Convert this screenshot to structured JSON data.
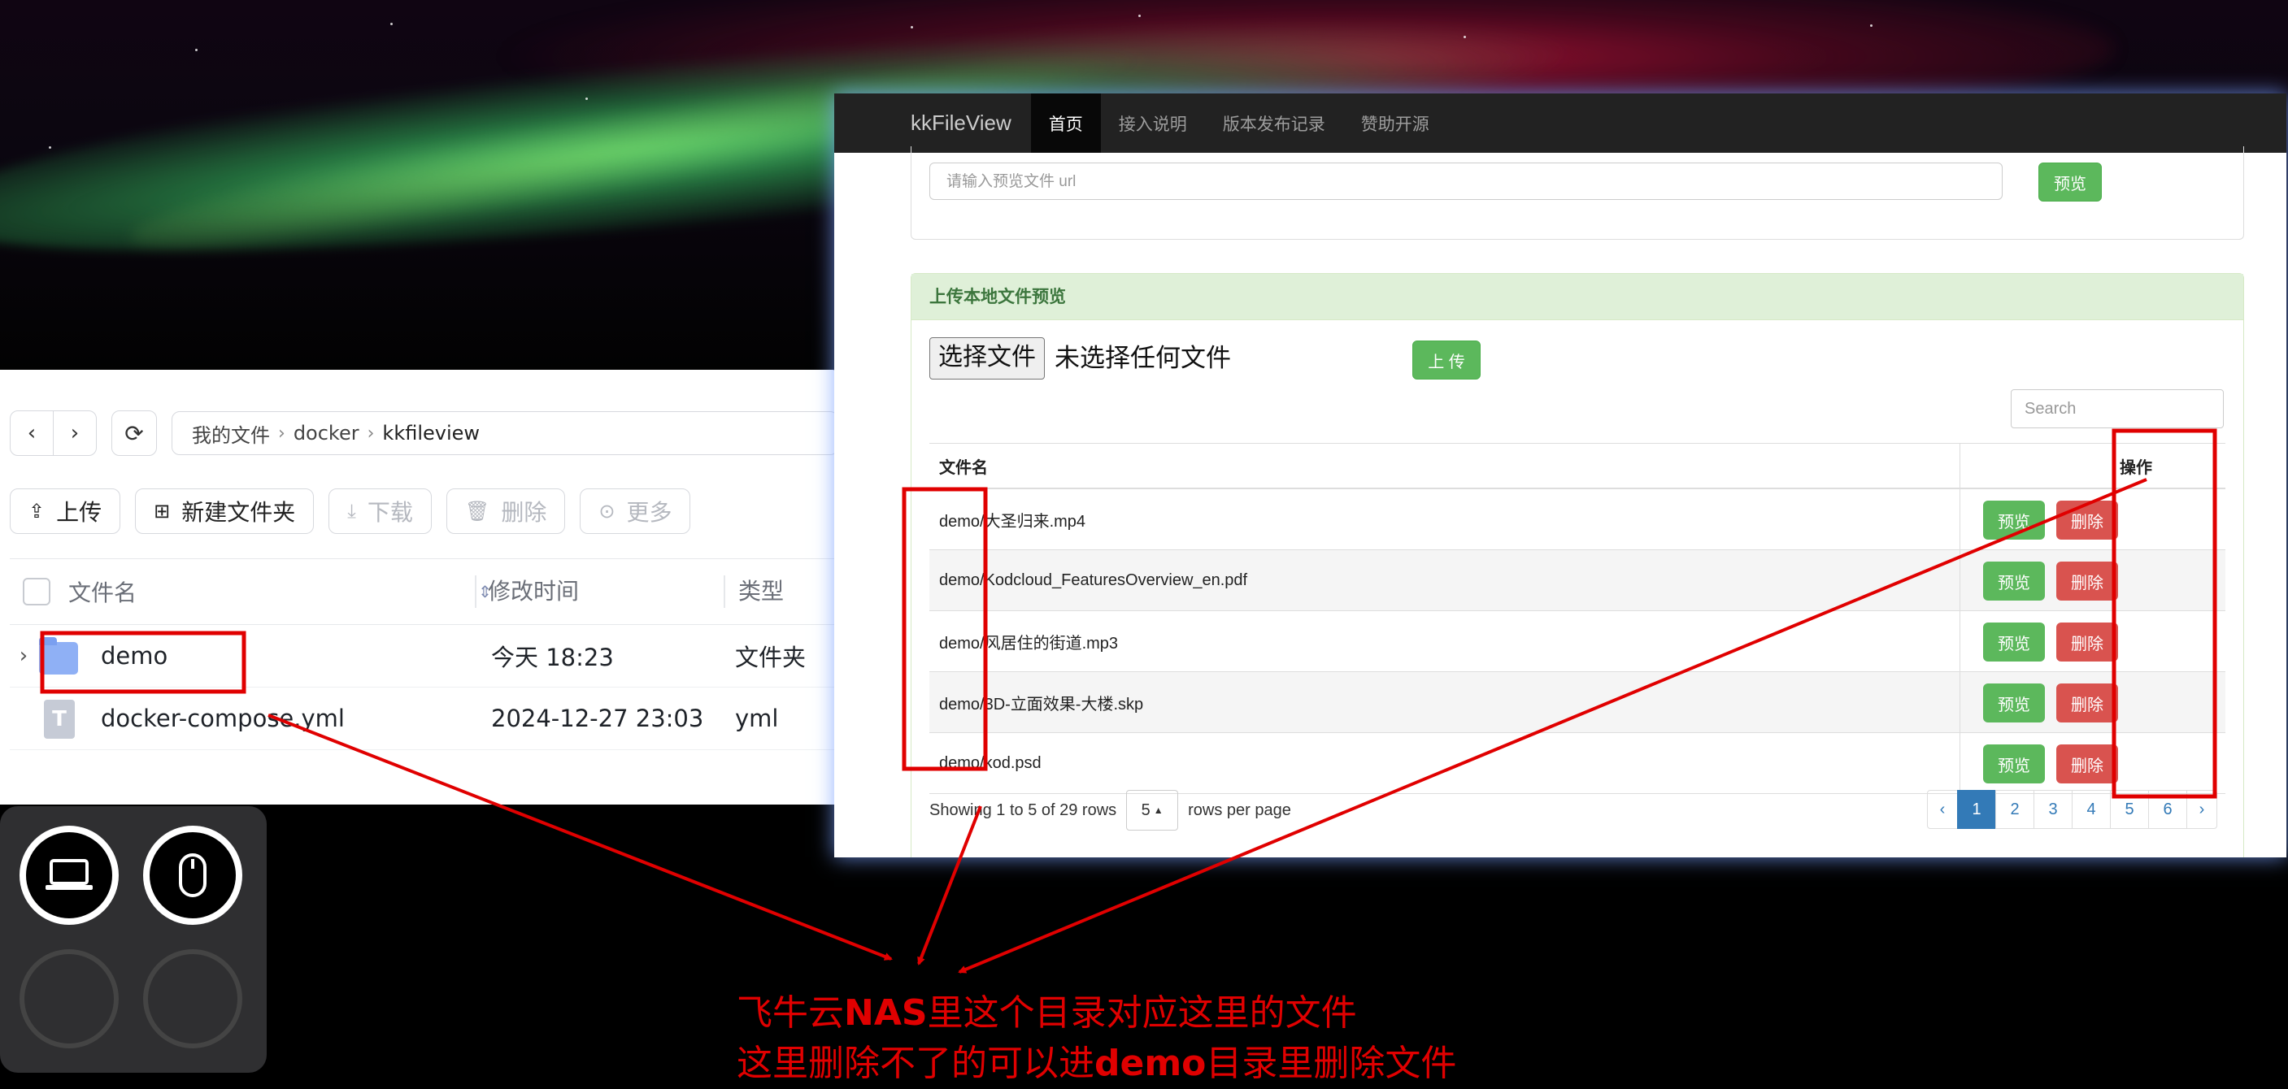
{
  "file_manager": {
    "nav": {
      "back_icon": "chevron-left-icon",
      "forward_icon": "chevron-right-icon",
      "refresh_icon": "refresh-icon"
    },
    "breadcrumb": [
      "我的文件",
      "docker",
      "kkfileview"
    ],
    "toolbar": {
      "upload": "上传",
      "new_folder": "新建文件夹",
      "download": "下载",
      "delete": "删除",
      "more": "更多"
    },
    "columns": {
      "name": "文件名",
      "modified": "修改时间",
      "type": "类型"
    },
    "rows": [
      {
        "name": "demo",
        "modified": "今天 18:23",
        "type": "文件夹",
        "kind": "folder"
      },
      {
        "name": "docker-compose.yml",
        "modified": "2024-12-27 23:03",
        "type": "yml",
        "kind": "file"
      }
    ]
  },
  "dock": {
    "buttons": [
      "laptop-icon",
      "mouse-icon",
      "",
      ""
    ]
  },
  "kk": {
    "brand": "kkFileView",
    "tabs": [
      "首页",
      "接入说明",
      "版本发布记录",
      "赞助开源"
    ],
    "active_tab": "首页",
    "url_placeholder": "请输入预览文件 url",
    "preview_button": "预览",
    "upload_panel_title": "上传本地文件预览",
    "choose_file": "选择文件",
    "no_file": "未选择任何文件",
    "upload_button": "上 传",
    "search_placeholder": "Search",
    "table": {
      "col_name": "文件名",
      "col_ops": "操作",
      "preview": "预览",
      "delete": "删除",
      "rows": [
        "demo/大圣归来.mp4",
        "demo/Kodcloud_FeaturesOverview_en.pdf",
        "demo/风居住的街道.mp3",
        "demo/3D-立面效果-大楼.skp",
        "demo/kod.psd"
      ]
    },
    "pagination": {
      "showing": "Showing 1 to 5 of 29 rows",
      "page_size": "5",
      "rows_per_page": "rows per page",
      "pages": [
        "‹",
        "1",
        "2",
        "3",
        "4",
        "5",
        "6",
        "›"
      ],
      "active_page": "1"
    }
  },
  "annotation": {
    "line1_parts": [
      "飞牛云",
      "NAS",
      "里这个目录对应这里的文件"
    ],
    "line2_parts": [
      "这里删除不了的可以进",
      "demo",
      "目录里删除文件"
    ],
    "color": "#e00000"
  }
}
